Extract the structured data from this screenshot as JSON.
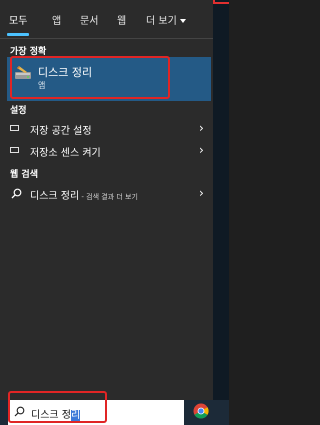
{
  "tabs": [
    {
      "label": "모두"
    },
    {
      "label": "앱"
    },
    {
      "label": "문서"
    },
    {
      "label": "웹"
    },
    {
      "label": "더 보기"
    }
  ],
  "best_match": {
    "section": "가장 정확",
    "title": "디스크 정리",
    "subtitle": "앱",
    "icon": "disk-cleanup-icon"
  },
  "settings": {
    "section": "설정",
    "items": [
      {
        "label": "저장 공간 설정",
        "icon": "storage-icon"
      },
      {
        "label": "저장소 센스 켜기",
        "icon": "storage-icon"
      }
    ]
  },
  "web_search": {
    "section": "웹 검색",
    "query": "디스크 정리",
    "suffix": " - 검색 결과 더 보기"
  },
  "taskbar": {
    "search_text": "디스크 정",
    "search_selected": "리",
    "apps": [
      "chrome-icon"
    ]
  },
  "colors": {
    "accent": "#4cc2ff",
    "highlight": "#245a86",
    "annotation": "#e02525"
  }
}
